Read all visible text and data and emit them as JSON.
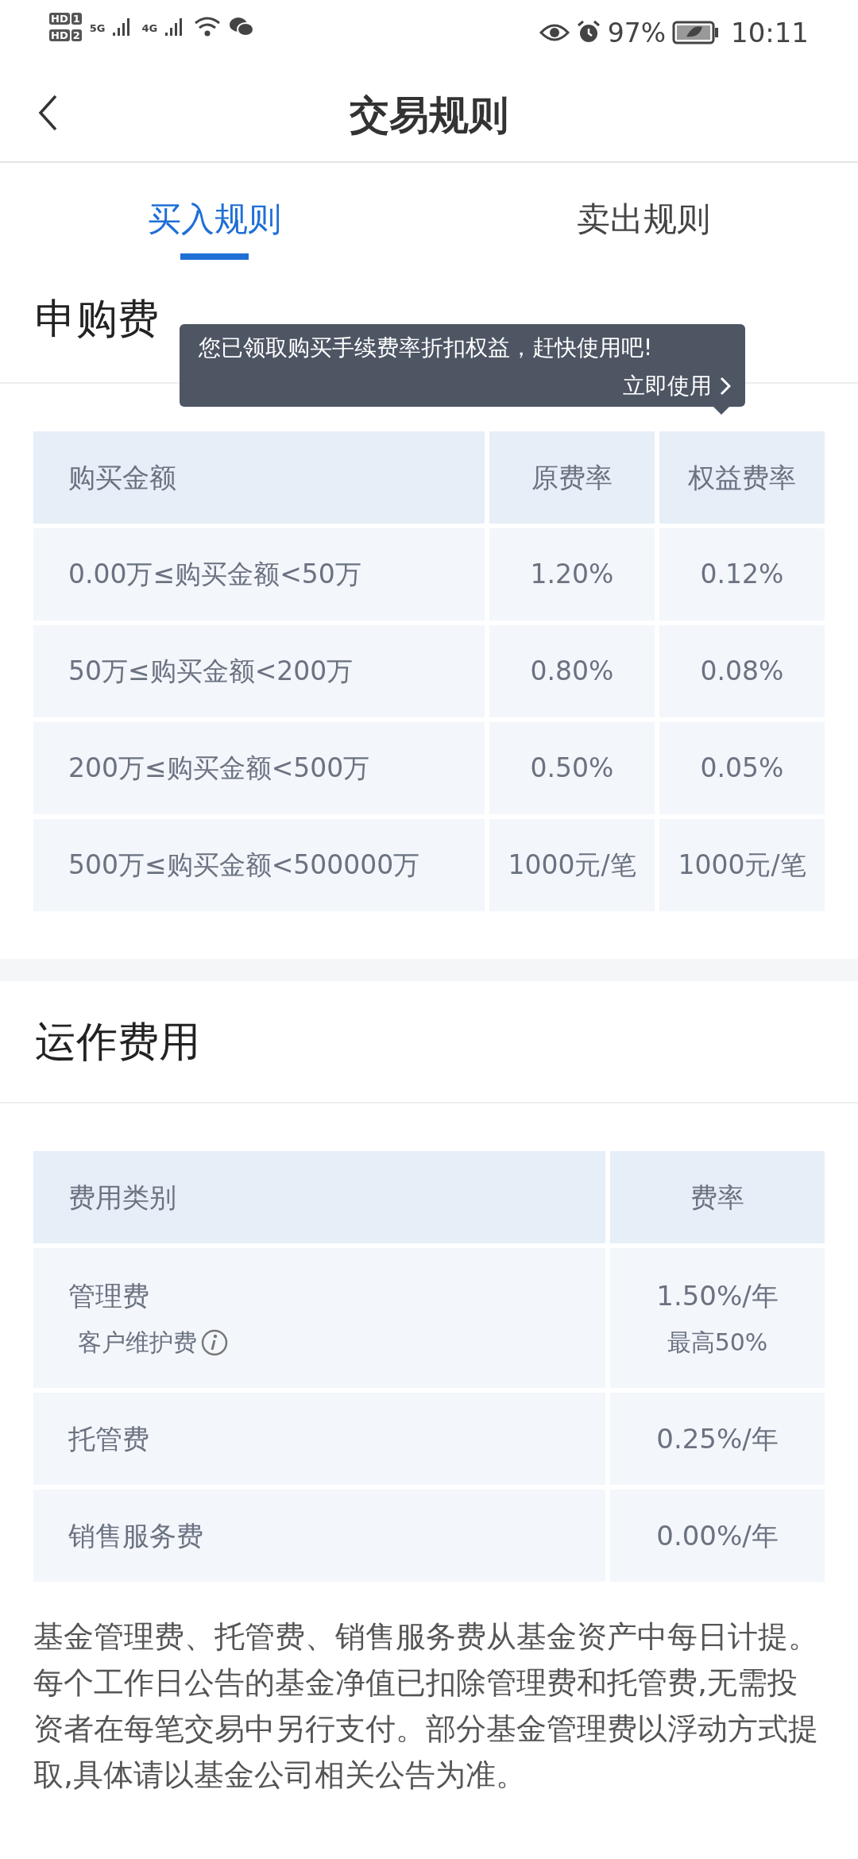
{
  "status_bar": {
    "sims": [
      {
        "label": "HD",
        "slot": "1"
      },
      {
        "label": "HD",
        "slot": "2"
      }
    ],
    "networks": [
      "5G",
      "4G"
    ],
    "battery": "97%",
    "time": "10:11"
  },
  "header": {
    "title": "交易规则"
  },
  "tabs": [
    {
      "label": "买入规则",
      "selected": true
    },
    {
      "label": "卖出规则",
      "selected": false
    }
  ],
  "purchase_fee": {
    "title": "申购费",
    "tooltip": {
      "text": "您已领取购买手续费率折扣权益，赶快使用吧!",
      "action": "立即使用"
    },
    "columns": [
      "购买金额",
      "原费率",
      "权益费率"
    ],
    "rows": [
      [
        "0.00万≤购买金额<50万",
        "1.20%",
        "0.12%"
      ],
      [
        "50万≤购买金额<200万",
        "0.80%",
        "0.08%"
      ],
      [
        "200万≤购买金额<500万",
        "0.50%",
        "0.05%"
      ],
      [
        "500万≤购买金额<500000万",
        "1000元/笔",
        "1000元/笔"
      ]
    ]
  },
  "operating_fee": {
    "title": "运作费用",
    "columns": [
      "费用类别",
      "费率"
    ],
    "rows": [
      {
        "name": "管理费",
        "sub": "客户维护费",
        "rate": "1.50%/年",
        "sub_rate": "最高50%"
      },
      {
        "name": "托管费",
        "rate": "0.25%/年"
      },
      {
        "name": "销售服务费",
        "rate": "0.00%/年"
      }
    ],
    "note": "基金管理费、托管费、销售服务费从基金资产中每日计提。每个工作日公告的基金净值已扣除管理费和托管费,无需投资者在每笔交易中另行支付。部分基金管理费以浮动方式提取,具体请以基金公司相关公告为准。"
  }
}
